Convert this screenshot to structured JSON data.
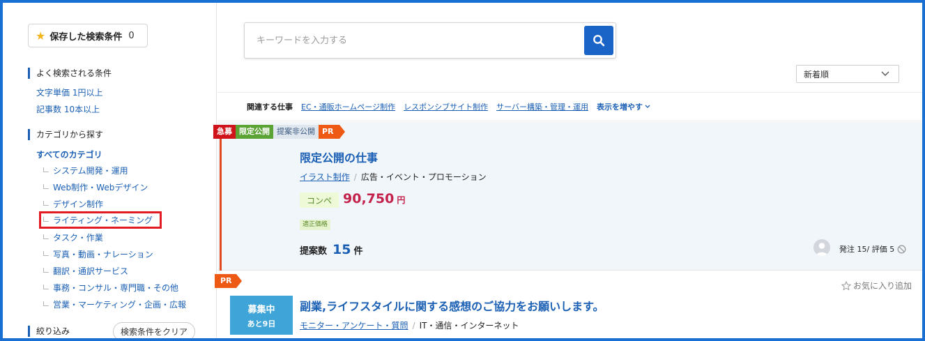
{
  "sidebar": {
    "saved_label": "保存した検索条件",
    "saved_count": "0",
    "popular_heading": "よく検索される条件",
    "popular_links": [
      "文字単価 1円以上",
      "記事数 10本以上"
    ],
    "category_heading": "カテゴリから探す",
    "all_categories": "すべてのカテゴリ",
    "categories": [
      "システム開発・運用",
      "Web制作・Webデザイン",
      "デザイン制作",
      "ライティング・ネーミング",
      "タスク・作業",
      "写真・動画・ナレーション",
      "翻訳・通訳サービス",
      "事務・コンサル・専門職・その他",
      "営業・マーケティング・企画・広報"
    ],
    "filter_heading": "絞り込み",
    "clear_label": "検索条件をクリア"
  },
  "search": {
    "placeholder": "キーワードを入力する"
  },
  "sort": {
    "selected": "新着順"
  },
  "related": {
    "label": "関連する仕事",
    "links": [
      "EC・通販ホームページ制作",
      "レスポンシブサイト制作",
      "サーバー構築・管理・運用"
    ],
    "more": "表示を増やす"
  },
  "job1": {
    "tags": [
      "急募",
      "限定公開",
      "提案非公開",
      "PR"
    ],
    "title": "限定公開の仕事",
    "category_link": "イラスト制作",
    "category_parent": "広告・イベント・プロモーション",
    "type": "コンペ",
    "price": "90,750",
    "price_unit": "円",
    "fair_badge": "適正価格",
    "proposals_label": "提案数",
    "proposals_count": "15",
    "proposals_unit": "件",
    "orders_text": "発注 15/ 評価 5"
  },
  "job2": {
    "tag": "PR",
    "favorite": "お気に入り追加",
    "status": "募集中",
    "days_left": "あと9日",
    "title": "副業,ライフスタイルに関する感想のご協力をお願いします。",
    "category_link": "モニター・アンケート・質問",
    "category_parent": "IT・通信・インターネット"
  },
  "colors": {
    "accent": "#1a5fb4",
    "frame": "#1a6fd3",
    "price": "#c3224b",
    "pr": "#ee5a14",
    "highlight": "#e21b23"
  }
}
